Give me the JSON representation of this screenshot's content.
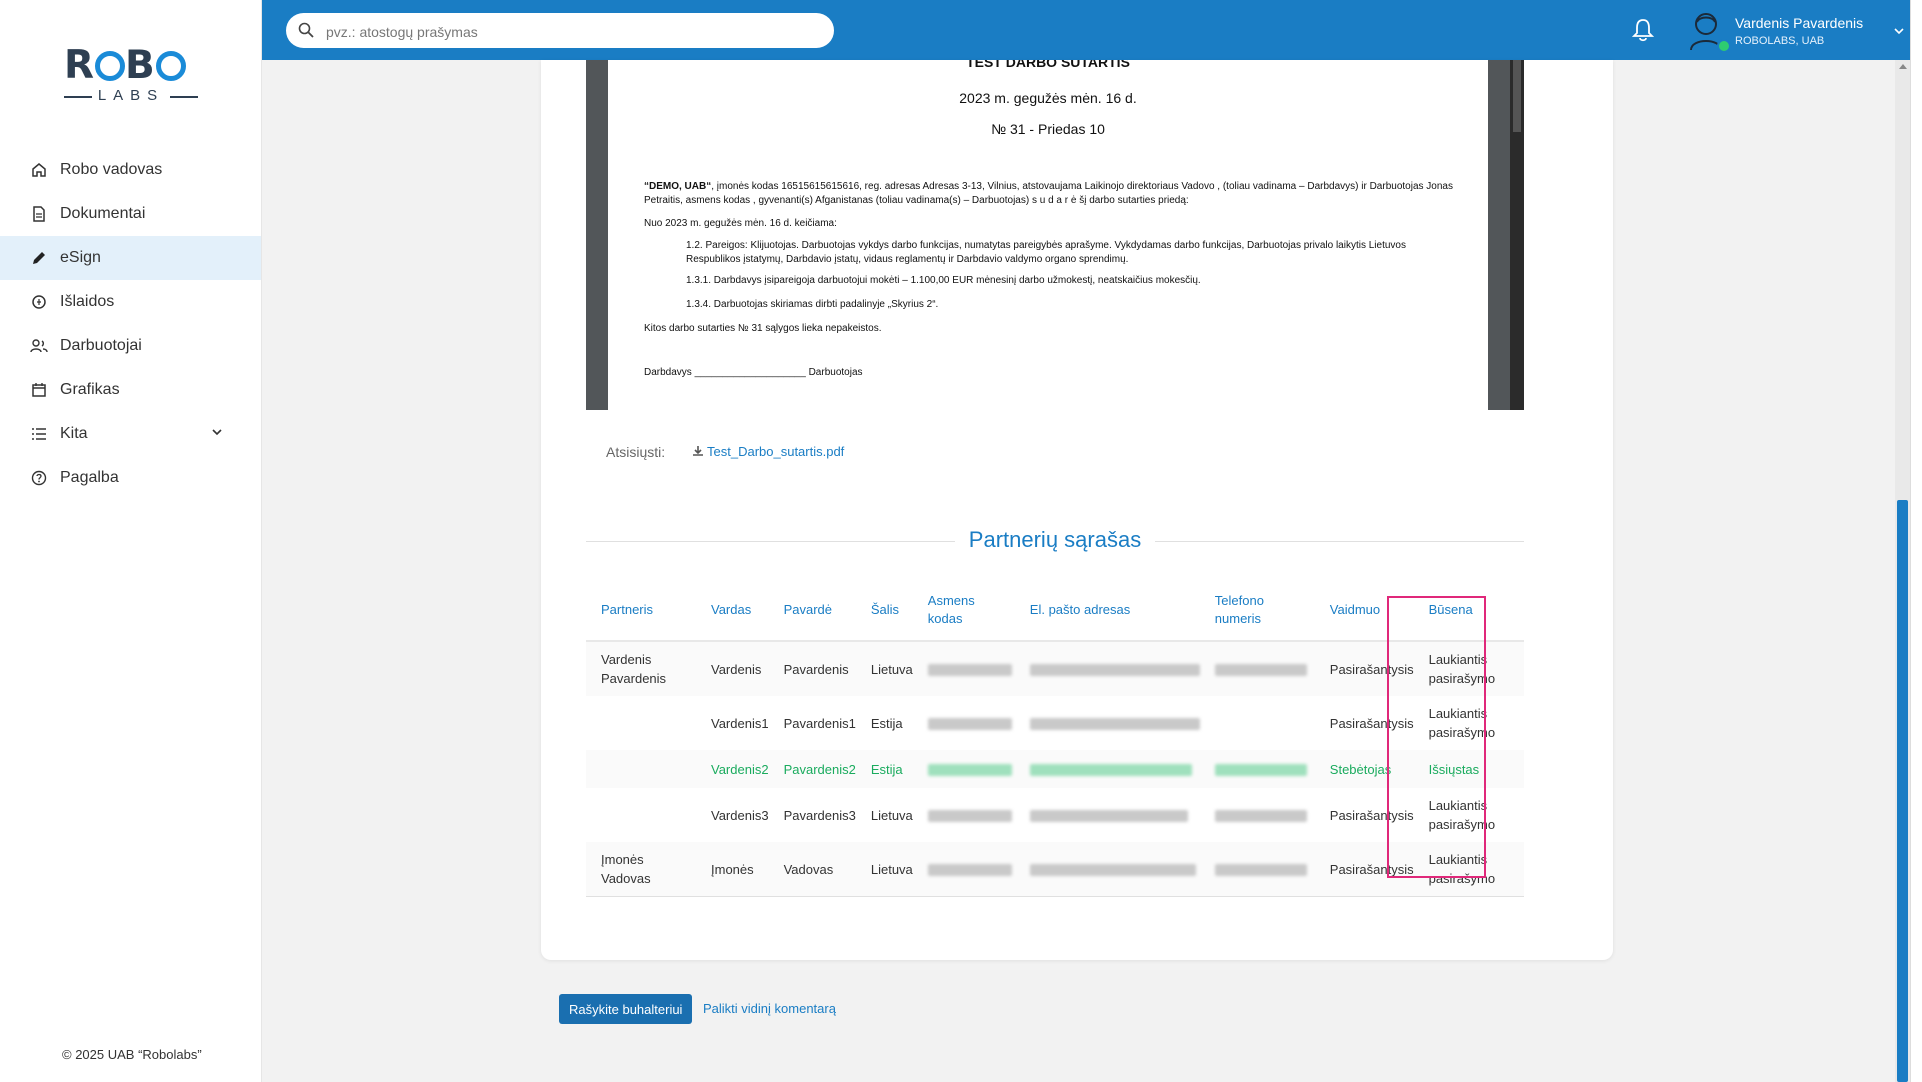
{
  "sidebar": {
    "logo_top": "ROBO",
    "logo_bottom": "LABS",
    "items": [
      {
        "label": "Robo vadovas",
        "icon": "home-icon"
      },
      {
        "label": "Dokumentai",
        "icon": "document-icon"
      },
      {
        "label": "eSign",
        "icon": "pen-icon",
        "active": true
      },
      {
        "label": "Išlaidos",
        "icon": "expenses-icon"
      },
      {
        "label": "Darbuotojai",
        "icon": "users-icon"
      },
      {
        "label": "Grafikas",
        "icon": "calendar-icon"
      },
      {
        "label": "Kita",
        "icon": "list-icon"
      },
      {
        "label": "Pagalba",
        "icon": "help-icon"
      }
    ],
    "copyright": "© 2025 UAB “Robolabs”"
  },
  "header": {
    "search_placeholder": "pvz.: atostogų prašymas",
    "user_name": "Vardenis Pavardenis",
    "user_company": "ROBOLABS, UAB"
  },
  "document": {
    "title": "TEST DARBO SUTARTIS",
    "date": "2023 m. gegužės mėn. 16 d.",
    "number": "№ 31 - Priedas 10",
    "intro_bold": "“DEMO, UAB“",
    "intro": ", įmonės kodas 16515615615616, reg. adresas Adresas 3-13, Vilnius, atstovaujama Laikinojo direktoriaus Vadovo , (toliau vadinama – Darbdavys) ir Darbuotojas Jonas Petraitis, asmens kodas , gyvenanti(s) Afganistanas (toliau vadinama(s) – Darbuotojas) s u d a r ė šį darbo sutarties priedą:",
    "changed_from": "Nuo 2023 m. gegužės mėn. 16 d. keičiama:",
    "p12": "1.2. Pareigos: Klijuotojas. Darbuotojas vykdys darbo funkcijas, numatytas pareigybės aprašyme. Vykdydamas darbo funkcijas, Darbuotojas privalo laikytis Lietuvos Respublikos įstatymų, Darbdavio įstatų, vidaus reglamentų ir Darbdavio valdymo organo sprendimų.",
    "p131": "1.3.1. Darbdavys įsipareigoja darbuotojui mokėti – 1.100,00 EUR mėnesinį darbo užmokestį, neatskaičius mokesčių.",
    "p134": "1.3.4. Darbuotojas skiriamas dirbti padalinyje „Skyrius 2“.",
    "other": "Kitos darbo sutarties № 31 sąlygos lieka nepakeistos.",
    "signature": "Darbdavys ____________________ Darbuotojas"
  },
  "download": {
    "label": "Atsisiųsti:",
    "file": "Test_Darbo_sutartis.pdf"
  },
  "partners": {
    "title": "Partnerių sąrašas",
    "columns": {
      "partneris": "Partneris",
      "vardas": "Vardas",
      "pavarde": "Pavardė",
      "salis": "Šalis",
      "asmens_kodas_1": "Asmens",
      "asmens_kodas_2": "kodas",
      "email": "El. pašto adresas",
      "phone_1": "Telefono",
      "phone_2": "numeris",
      "vaidmuo": "Vaidmuo",
      "busena": "Būsena"
    },
    "rows": [
      {
        "partneris_1": "Vardenis",
        "partneris_2": "Pavardenis",
        "vardas": "Vardenis",
        "pavarde": "Pavardenis",
        "salis": "Lietuva",
        "vaidmuo": "Pasirašantysis",
        "busena_1": "Laukiantis",
        "busena_2": "pasirašymo"
      },
      {
        "partneris_1": "",
        "partneris_2": "",
        "vardas": "Vardenis1",
        "pavarde": "Pavardenis1",
        "salis": "Estija",
        "vaidmuo": "Pasirašantysis",
        "busena_1": "Laukiantis",
        "busena_2": "pasirašymo"
      },
      {
        "partneris_1": "",
        "partneris_2": "",
        "vardas": "Vardenis2",
        "pavarde": "Pavardenis2",
        "salis": "Estija",
        "vaidmuo": "Stebėtojas",
        "busena_1": "Išsiųstas",
        "busena_2": ""
      },
      {
        "partneris_1": "",
        "partneris_2": "",
        "vardas": "Vardenis3",
        "pavarde": "Pavardenis3",
        "salis": "Lietuva",
        "vaidmuo": "Pasirašantysis",
        "busena_1": "Laukiantis",
        "busena_2": "pasirašymo"
      },
      {
        "partneris_1": "Įmonės Vadovas",
        "partneris_2": "",
        "vardas": "Įmonės",
        "pavarde": "Vadovas",
        "salis": "Lietuva",
        "vaidmuo": "Pasirašantysis",
        "busena_1": "Laukiantis",
        "busena_2": "pasirašymo"
      }
    ]
  },
  "actions": {
    "primary": "Rašykite buhalteriui",
    "secondary": "Palikti vidinį komentarą"
  },
  "colors": {
    "brand": "#1a7dc4",
    "status_sent": "#1aab5e",
    "highlight": "#e0287a"
  }
}
